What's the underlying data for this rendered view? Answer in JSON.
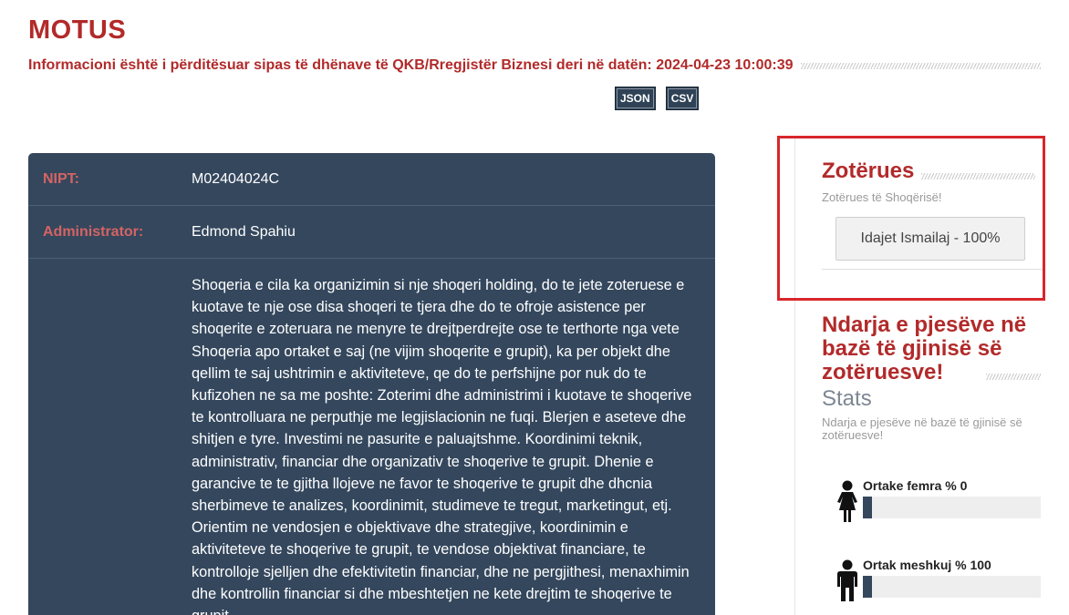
{
  "header": {
    "company_name": "MOTUS",
    "update_text": "Informacioni është i përditësuar sipas të dhënave të QKB/Rregjistër Biznesi deri në datën: 2024-04-23 10:00:39",
    "export_json": "JSON",
    "export_csv": "CSV"
  },
  "info": {
    "nipt_label": "NIPT:",
    "nipt_value": "M02404024C",
    "admin_label": "Administrator:",
    "admin_value": "Edmond Spahiu",
    "description": "Shoqeria e cila ka organizimin si nje shoqeri holding, do te jete zoteruese e kuotave te nje ose disa shoqeri te tjera dhe do te ofroje asistence per shoqerite e zoteruara ne menyre te drejtperdrejte ose te terthorte nga vete Shoqeria apo ortaket e saj (ne vijim shoqerite e grupit), ka per objekt dhe qellim te saj ushtrimin e aktiviteteve, qe do te perfshijne por nuk do te kufizohen ne sa me poshte: Zoterimi dhe administrimi i kuotave te shoqerive te kontrolluara ne perputhje me legjislacionin ne fuqi. Blerjen e aseteve dhe shitjen e tyre. Investimi ne pasurite e paluajtshme. Koordinimi teknik, administrativ, financiar dhe organizativ te shoqerive te grupit. Dhenie e garancive te te gjitha llojeve ne favor te shoqerive te grupit dhe dhcnia sherbimeve te analizes, koordinimit, studimeve te tregut, marketingut, etj. Orientim ne vendosjen e objektivave dhe strategjive, koordinimin e aktiviteteve te shoqerive te grupit, te vendose objektivat financiare, te kontrolloje sjelljen dhe efektivitetin financiar, dhe ne pergjithesi, menaxhimin dhe kontrollin financiar si dhe mbeshtetjen ne kete drejtim te shoqerive te grupit."
  },
  "owners": {
    "title": "Zotërues",
    "subtitle": "Zotërues të Shoqërisë!",
    "items": [
      {
        "label": "Idajet Ismailaj - 100%"
      }
    ]
  },
  "distribution": {
    "title": "Ndarja e pjesëve në bazë të gjinisë së zotëruesve!",
    "stats_label": "Stats",
    "stats_sub": "Ndarja e pjesëve në bazë të gjinisë së zotëruesve!",
    "female": {
      "label": "Ortake femra % 0",
      "percent": 0
    },
    "male": {
      "label": "Ortak meshkuj % 100",
      "percent": 100
    },
    "bar_color": "#34475d"
  }
}
